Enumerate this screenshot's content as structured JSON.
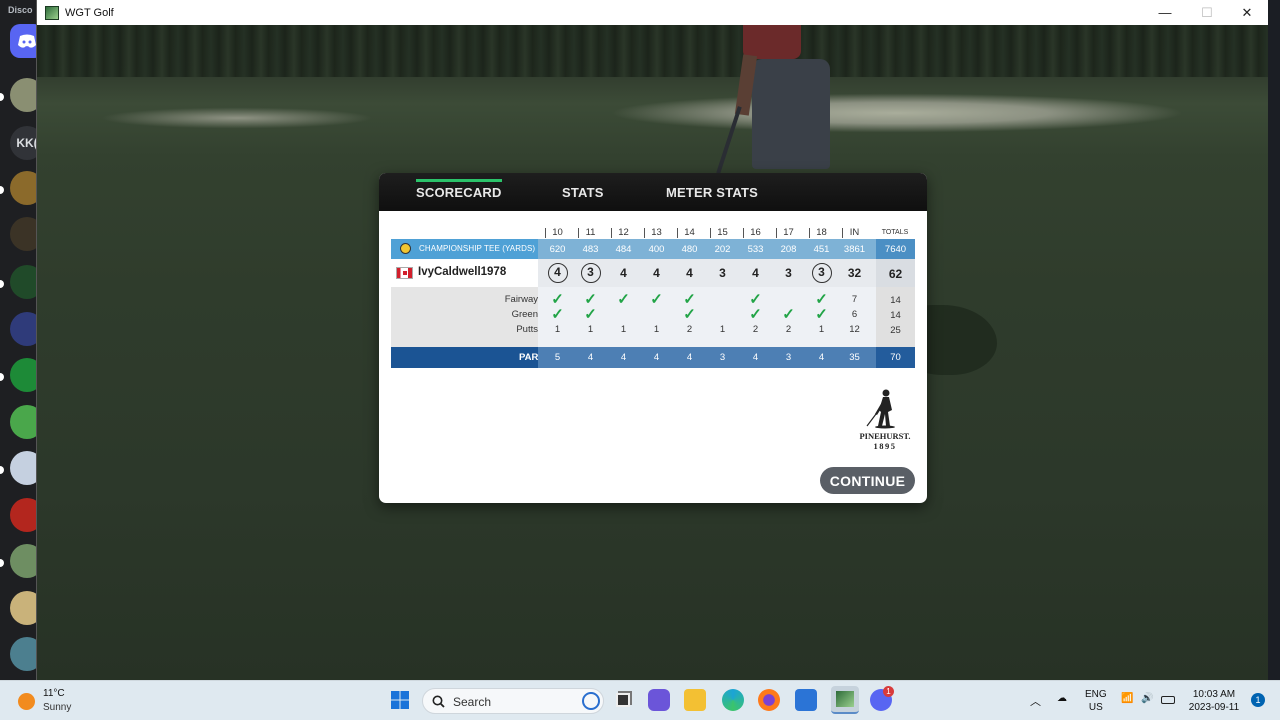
{
  "discord": {
    "title": "Disco",
    "server_text": "KK("
  },
  "window": {
    "title": "WGT Golf",
    "minimize": "—",
    "maximize": "☐",
    "close": "✕"
  },
  "tabs": [
    "SCORECARD",
    "STATS",
    "METER STATS"
  ],
  "scorecard": {
    "holes": [
      "10",
      "11",
      "12",
      "13",
      "14",
      "15",
      "16",
      "17",
      "18",
      "IN"
    ],
    "totals_header": "TOTALS",
    "tee": {
      "label": "CHAMPIONSHIP TEE (YARDS)",
      "yards": [
        "620",
        "483",
        "484",
        "400",
        "480",
        "202",
        "533",
        "208",
        "451",
        "3861"
      ],
      "total": "7640"
    },
    "player": {
      "name": "IvyCaldwell1978",
      "scores": [
        "4",
        "3",
        "4",
        "4",
        "4",
        "3",
        "4",
        "3",
        "3",
        "32"
      ],
      "circled": [
        true,
        true,
        false,
        false,
        false,
        false,
        false,
        false,
        true,
        false
      ],
      "total": "62"
    },
    "stats": [
      {
        "label": "Fairway",
        "marks": [
          "✓",
          "✓",
          "✓",
          "✓",
          "✓",
          "",
          "✓",
          "",
          "✓"
        ],
        "in": "7",
        "total": "14"
      },
      {
        "label": "Green",
        "marks": [
          "✓",
          "✓",
          "",
          "",
          "✓",
          "",
          "✓",
          "✓",
          "✓"
        ],
        "in": "6",
        "total": "14"
      },
      {
        "label": "Putts",
        "marks": [
          "1",
          "1",
          "1",
          "1",
          "2",
          "1",
          "2",
          "2",
          "1"
        ],
        "in": "12",
        "total": "25"
      }
    ],
    "par": {
      "label": "PAR",
      "values": [
        "5",
        "4",
        "4",
        "4",
        "4",
        "3",
        "4",
        "3",
        "4",
        "35"
      ],
      "total": "70"
    }
  },
  "logo": {
    "text": "PINEHURST.",
    "year": "1895"
  },
  "continue_label": "CONTINUE",
  "taskbar": {
    "weather_temp": "11°C",
    "weather_cond": "Sunny",
    "search_placeholder": "Search",
    "lang1": "ENG",
    "lang2": "US",
    "time": "10:03 AM",
    "date": "2023-09-11",
    "notif_count": "1",
    "discord_badge": "1"
  }
}
